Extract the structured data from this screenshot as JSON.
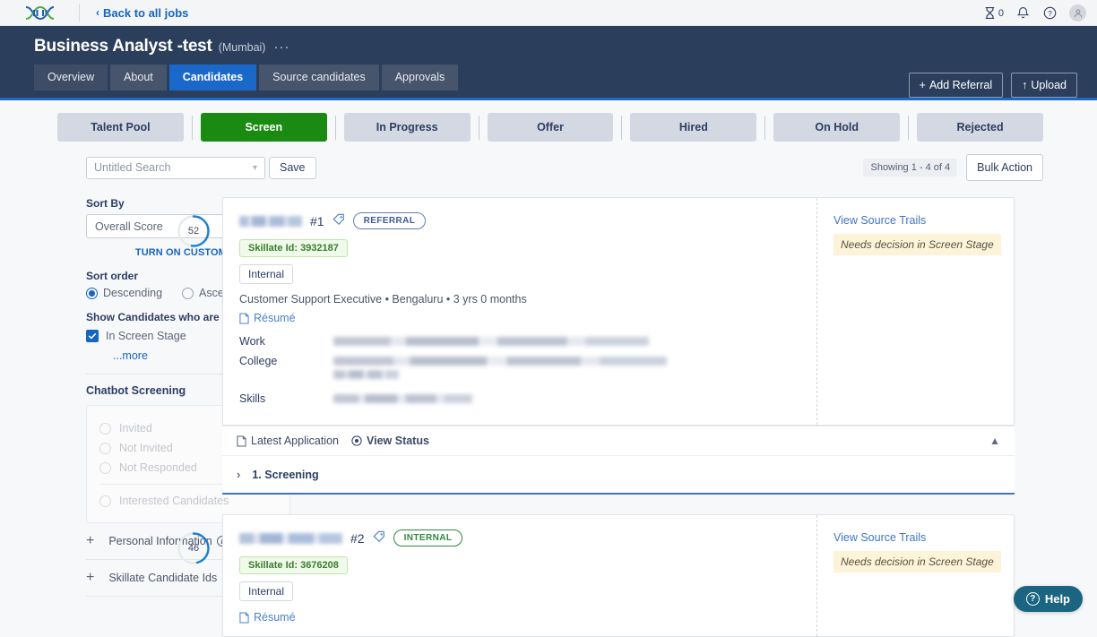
{
  "topbar": {
    "logo_name": "dna-helix-logo",
    "back_label": "Back to all jobs",
    "hourglass_count": "0",
    "icons": [
      "hourglass-icon",
      "bell-icon",
      "help-circle-icon",
      "user-avatar-icon"
    ]
  },
  "header": {
    "job_title": "Business Analyst -test",
    "job_location": "(Mumbai)",
    "more_dots": "···",
    "tabs": [
      {
        "label": "Overview",
        "active": false
      },
      {
        "label": "About",
        "active": false
      },
      {
        "label": "Candidates",
        "active": true
      },
      {
        "label": "Source candidates",
        "active": false
      },
      {
        "label": "Approvals",
        "active": false
      }
    ],
    "add_referral_label": "Add Referral",
    "add_referral_icon": "plus-icon",
    "upload_label": "Upload",
    "upload_icon": "upload-arrow-icon"
  },
  "stages": [
    {
      "label": "Talent Pool",
      "selected": false
    },
    {
      "label": "Screen",
      "selected": true
    },
    {
      "label": "In Progress",
      "selected": false
    },
    {
      "label": "Offer",
      "selected": false
    },
    {
      "label": "Hired",
      "selected": false
    },
    {
      "label": "On Hold",
      "selected": false
    },
    {
      "label": "Rejected",
      "selected": false
    }
  ],
  "search": {
    "saved_search_value": "Untitled Search",
    "save_label": "Save",
    "showing_label": "Showing 1 - 4 of 4",
    "bulk_action_label": "Bulk Action"
  },
  "sidebar": {
    "sort_by_label": "Sort By",
    "sort_by_value": "Overall Score",
    "custom_weightage_label": "TURN ON CUSTOM WEIGHTAGE",
    "sort_order_label": "Sort order",
    "sort_order_options": [
      {
        "label": "Descending",
        "selected": true
      },
      {
        "label": "Ascending",
        "selected": false
      }
    ],
    "show_candidates_label": "Show Candidates who are",
    "in_screen_stage_label": "In Screen Stage",
    "in_screen_stage_checked": true,
    "more_label": "...more",
    "chatbot_title": "Chatbot Screening",
    "chatbot_options": [
      "Invited",
      "Not Invited",
      "Not Responded",
      "Interested Candidates"
    ],
    "accordions": [
      {
        "label": "Personal Information",
        "has_info": true
      },
      {
        "label": "Skillate Candidate Ids",
        "has_info": false
      }
    ]
  },
  "candidates": [
    {
      "name_redacted": true,
      "rank": "#1",
      "tag_icon": "tag-icon",
      "badge": "REFERRAL",
      "badge_style": "blue",
      "skillate_id": "Skillate Id: 3932187",
      "internal_tag": "Internal",
      "meta": "Customer Support Executive • Bengaluru • 3 yrs 0 months",
      "resume_label": "Résumé",
      "details": [
        {
          "key": "Work",
          "redacted_lines": 1
        },
        {
          "key": "College",
          "redacted_lines": 2
        },
        {
          "key": "Skills",
          "redacted_lines": 1
        }
      ],
      "score": "52",
      "score_pct": 52,
      "source_trails_label": "View Source Trails",
      "status_note": "Needs decision in Screen Stage",
      "footer": {
        "latest_application_label": "Latest Application",
        "view_status_label": "View Status",
        "collapse_icon": "chevron-up-icon"
      },
      "stage_row": {
        "label": "1. Screening",
        "expand_icon": "chevron-right-icon"
      }
    },
    {
      "name_redacted": true,
      "rank": "#2",
      "tag_icon": "tag-icon",
      "badge": "INTERNAL",
      "badge_style": "green",
      "skillate_id": "Skillate Id: 3676208",
      "internal_tag": "Internal",
      "meta": "",
      "resume_label": "Résumé",
      "details": [],
      "score": "46",
      "score_pct": 46,
      "source_trails_label": "View Source Trails",
      "status_note": "Needs decision in Screen Stage"
    }
  ],
  "help": {
    "label": "Help",
    "icon": "question-circle-icon"
  },
  "colors": {
    "header_bg": "#2b3f5c",
    "accent_blue": "#1a68c9",
    "selected_stage_green": "#1a8a12",
    "link_blue": "#1665c0",
    "note_yellow": "#fcf3d9",
    "skillate_green": "#3a7d2c",
    "help_teal": "#1b6582"
  }
}
